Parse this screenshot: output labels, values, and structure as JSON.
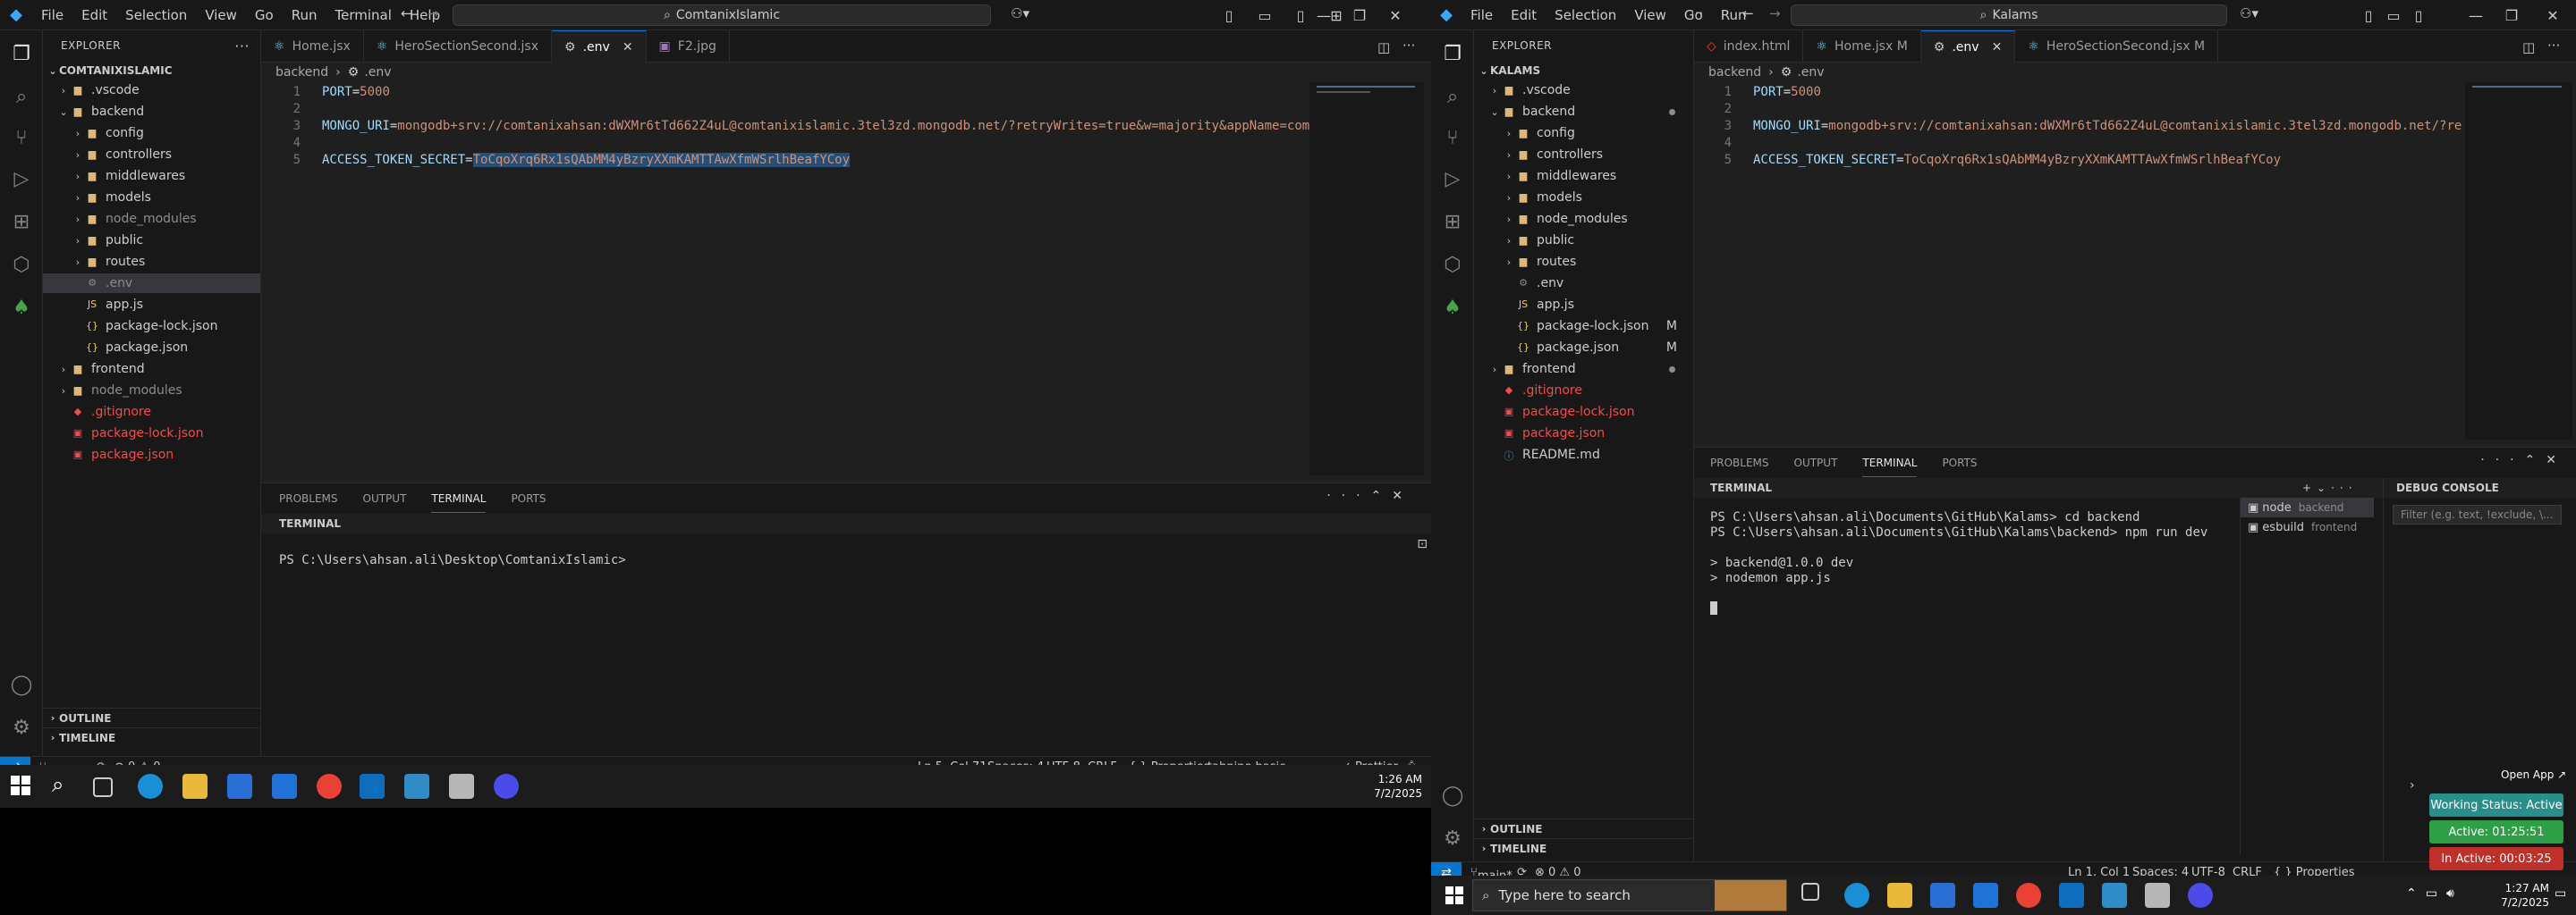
{
  "left": {
    "menu": [
      "File",
      "Edit",
      "Selection",
      "View",
      "Go",
      "Run",
      "Terminal",
      "Help"
    ],
    "search": "ComtanixIslamic",
    "explorer_title": "EXPLORER",
    "root": "COMTANIXISLAMIC",
    "tree": [
      {
        "label": ".vscode",
        "kind": "folder",
        "depth": 1,
        "open": false
      },
      {
        "label": "backend",
        "kind": "folder",
        "depth": 1,
        "open": true
      },
      {
        "label": "config",
        "kind": "folder",
        "depth": 2,
        "open": false
      },
      {
        "label": "controllers",
        "kind": "folder",
        "depth": 2,
        "open": false
      },
      {
        "label": "middlewares",
        "kind": "folder",
        "depth": 2,
        "open": false
      },
      {
        "label": "models",
        "kind": "folder",
        "depth": 2,
        "open": false
      },
      {
        "label": "node_modules",
        "kind": "folder",
        "depth": 2,
        "open": false,
        "muted": true
      },
      {
        "label": "public",
        "kind": "folder",
        "depth": 2,
        "open": false
      },
      {
        "label": "routes",
        "kind": "folder",
        "depth": 2,
        "open": false
      },
      {
        "label": ".env",
        "kind": "env",
        "depth": 2,
        "selected": true,
        "muted": true
      },
      {
        "label": "app.js",
        "kind": "js",
        "depth": 2
      },
      {
        "label": "package-lock.json",
        "kind": "json",
        "depth": 2
      },
      {
        "label": "package.json",
        "kind": "json",
        "depth": 2
      },
      {
        "label": "frontend",
        "kind": "folder",
        "depth": 1,
        "open": false
      },
      {
        "label": "node_modules",
        "kind": "folder",
        "depth": 1,
        "open": false,
        "muted": true
      },
      {
        "label": ".gitignore",
        "kind": "git",
        "depth": 1
      },
      {
        "label": "package-lock.json",
        "kind": "npm",
        "depth": 1
      },
      {
        "label": "package.json",
        "kind": "npm",
        "depth": 1
      }
    ],
    "tabs": [
      {
        "label": "Home.jsx",
        "active": false
      },
      {
        "label": "HeroSectionSecond.jsx",
        "active": false
      },
      {
        "label": ".env",
        "active": true
      },
      {
        "label": "F2.jpg",
        "active": false
      }
    ],
    "breadcrumb": [
      "backend",
      ".env"
    ],
    "code": [
      {
        "n": "1",
        "key": "PORT",
        "val": "5000"
      },
      {
        "n": "2",
        "key": "",
        "val": ""
      },
      {
        "n": "3",
        "key": "MONGO_URI",
        "val": "mongodb+srv://comtanixahsan:dWXMr6tTd662Z4uL@comtanixislamic.3tel3zd.mongodb.net/?retryWrites=true&w=majority&appName=comtanixislamic"
      },
      {
        "n": "4",
        "key": "",
        "val": ""
      },
      {
        "n": "5",
        "key": "ACCESS_TOKEN_SECRET",
        "val": "ToCqoXrq6Rx1sQAbMM4yBzryXXmKAMTTAwXfmWSrlhBeafYCoy"
      }
    ],
    "panel_tabs": [
      "PROBLEMS",
      "OUTPUT",
      "TERMINAL",
      "PORTS"
    ],
    "terminal_title": "TERMINAL",
    "terminal_lines": [
      "PS C:\\Users\\ahsan.ali\\Desktop\\ComtanixIslamic>"
    ],
    "sections": [
      "OUTLINE",
      "TIMELINE"
    ],
    "status_left": [
      "master",
      "⊗ 0 ⚠ 0"
    ],
    "status_right": [
      "Ln 5, Col 71",
      "Spaces: 4",
      "UTF-8",
      "CRLF",
      "{ } Properties",
      "tabnine basic",
      "✓ Prettier"
    ],
    "clock": {
      "time": "1:26 AM",
      "date": "7/2/2025"
    }
  },
  "right": {
    "menu": [
      "File",
      "Edit",
      "Selection",
      "View",
      "Go",
      "Run"
    ],
    "search": "Kalams",
    "explorer_title": "EXPLORER",
    "root": "KALAMS",
    "tree": [
      {
        "label": ".vscode",
        "kind": "folder",
        "depth": 1,
        "open": false
      },
      {
        "label": "backend",
        "kind": "folder",
        "depth": 1,
        "open": true,
        "dot": true
      },
      {
        "label": "config",
        "kind": "folder",
        "depth": 2,
        "open": false
      },
      {
        "label": "controllers",
        "kind": "folder",
        "depth": 2,
        "open": false
      },
      {
        "label": "middlewares",
        "kind": "folder",
        "depth": 2,
        "open": false
      },
      {
        "label": "models",
        "kind": "folder",
        "depth": 2,
        "open": false
      },
      {
        "label": "node_modules",
        "kind": "folder",
        "depth": 2,
        "open": false
      },
      {
        "label": "public",
        "kind": "folder",
        "depth": 2,
        "open": false
      },
      {
        "label": "routes",
        "kind": "folder",
        "depth": 2,
        "open": false
      },
      {
        "label": ".env",
        "kind": "env",
        "depth": 2
      },
      {
        "label": "app.js",
        "kind": "js",
        "depth": 2
      },
      {
        "label": "package-lock.json",
        "kind": "json",
        "depth": 2,
        "badge": "M"
      },
      {
        "label": "package.json",
        "kind": "json",
        "depth": 2,
        "badge": "M"
      },
      {
        "label": "frontend",
        "kind": "folder",
        "depth": 1,
        "open": false,
        "dot": true
      },
      {
        "label": ".gitignore",
        "kind": "git",
        "depth": 1
      },
      {
        "label": "package-lock.json",
        "kind": "npm",
        "depth": 1
      },
      {
        "label": "package.json",
        "kind": "npm",
        "depth": 1
      },
      {
        "label": "README.md",
        "kind": "md",
        "depth": 1
      }
    ],
    "tabs": [
      {
        "label": "index.html",
        "active": false
      },
      {
        "label": "Home.jsx M",
        "active": false
      },
      {
        "label": ".env",
        "active": true
      },
      {
        "label": "HeroSectionSecond.jsx M",
        "active": false
      }
    ],
    "breadcrumb": [
      "backend",
      ".env"
    ],
    "code": [
      {
        "n": "1",
        "key": "PORT",
        "val": "5000"
      },
      {
        "n": "2",
        "key": "",
        "val": ""
      },
      {
        "n": "3",
        "key": "MONGO_URI",
        "val": "mongodb+srv://comtanixahsan:dWXMr6tTd662Z4uL@comtanixislamic.3tel3zd.mongodb.net/?retryWrites"
      },
      {
        "n": "4",
        "key": "",
        "val": ""
      },
      {
        "n": "5",
        "key": "ACCESS_TOKEN_SECRET",
        "val": "ToCqoXrq6Rx1sQAbMM4yBzryXXmKAMTTAwXfmWSrlhBeafYCoy"
      }
    ],
    "panel_tabs": [
      "PROBLEMS",
      "OUTPUT",
      "TERMINAL",
      "PORTS"
    ],
    "terminal_title": "TERMINAL",
    "debug_title": "DEBUG CONSOLE",
    "debug_filter": "Filter (e.g. text, !exclude, \\...",
    "terminal_lines": [
      "PS C:\\Users\\ahsan.ali\\Documents\\GitHub\\Kalams> cd backend",
      "PS C:\\Users\\ahsan.ali\\Documents\\GitHub\\Kalams\\backend> npm run dev",
      "",
      "> backend@1.0.0 dev",
      "> nodemon app.js"
    ],
    "term_list": [
      {
        "name": "node",
        "detail": "backend"
      },
      {
        "name": "esbuild",
        "detail": "frontend"
      }
    ],
    "sections": [
      "OUTLINE",
      "TIMELINE"
    ],
    "status_left": [
      "main*",
      "⊗ 0 ⚠ 0"
    ],
    "status_right": [
      "Ln 1, Col 1",
      "Spaces: 4",
      "UTF-8",
      "CRLF",
      "{ } Properties"
    ],
    "overlay": {
      "open_app": "Open App ↗",
      "working": "Working Status: Active",
      "active": "Active: 01:25:51",
      "inactive": "In Active: 00:03:25"
    },
    "taskbar_search": "Type here to search",
    "clock": {
      "time": "1:27 AM",
      "date": "7/2/2025"
    }
  }
}
